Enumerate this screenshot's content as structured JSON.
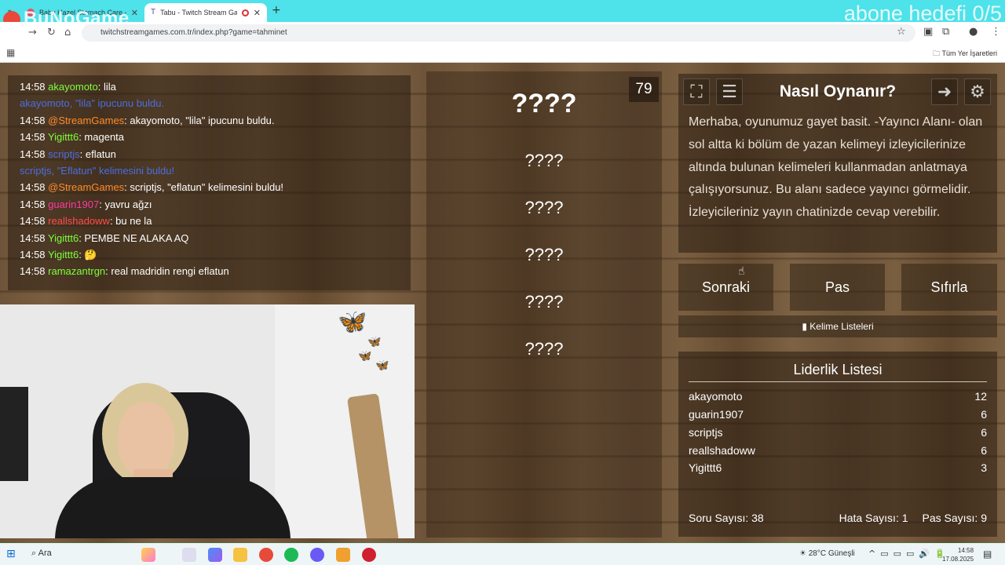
{
  "browser": {
    "tabs": [
      {
        "label": "Baby Hazel Stomach Care - Oy...",
        "active": false
      },
      {
        "label": "Tabu - Twitch Stream Games",
        "active": true
      }
    ],
    "url": "twitchstreamgames.com.tr/index.php?game=tahminet",
    "bookmarks_folder": "Tüm Yer İşaretleri",
    "overlay_logo": "BuNoGame",
    "overlay_goal": "abone hedefi 0/5"
  },
  "chat": {
    "messages": [
      {
        "time": "14:58",
        "user": "akayomoto",
        "user_color": "#7cff3a",
        "text": ": lila"
      },
      {
        "system": true,
        "text": "akayomoto, \"lila\" ipucunu buldu."
      },
      {
        "time": "14:58",
        "user": "@StreamGames",
        "user_color": "#ff8c2a",
        "text": ": akayomoto, \"lila\" ipucunu buldu."
      },
      {
        "time": "14:58",
        "user": "Yigittt6",
        "user_color": "#7cff3a",
        "text": ": magenta"
      },
      {
        "time": "14:58",
        "user": "scriptjs",
        "user_color": "#4a6ee0",
        "text": ": eflatun"
      },
      {
        "system": true,
        "text": "scriptjs, \"Eflatun\" kelimesini buldu!"
      },
      {
        "time": "14:58",
        "user": "@StreamGames",
        "user_color": "#ff8c2a",
        "text": ": scriptjs, \"eflatun\" kelimesini buldu!"
      },
      {
        "time": "14:58",
        "user": "guarin1907",
        "user_color": "#ff3aa0",
        "text": ": yavru ağzı"
      },
      {
        "time": "14:58",
        "user": "reallshadoww",
        "user_color": "#ff4a4a",
        "text": ": bu ne la"
      },
      {
        "time": "14:58",
        "user": "Yigittt6",
        "user_color": "#7cff3a",
        "text": ": PEMBE NE ALAKA AQ"
      },
      {
        "time": "14:58",
        "user": "Yigittt6",
        "user_color": "#7cff3a",
        "text": ": 🤔"
      },
      {
        "time": "14:58",
        "user": "ramazantrgn",
        "user_color": "#7cff3a",
        "text": ": real madridin rengi eflatun"
      }
    ]
  },
  "game": {
    "timer": "79",
    "main_word": "????",
    "taboo_words": [
      "????",
      "????",
      "????",
      "????",
      "????"
    ]
  },
  "help": {
    "title": "Nasıl Oynanır?",
    "text": "Merhaba, oyunumuz gayet basit. -Yayıncı Alanı- olan sol altta ki bölüm de yazan kelimeyi izleyicilerinize altında bulunan kelimeleri kullanmadan anlatmaya çalışıyorsunuz. Bu alanı sadece yayıncı görmelidir. İzleyicileriniz yayın chatinizde cevap verebilir."
  },
  "controls": {
    "next": "Sonraki",
    "pass": "Pas",
    "reset": "Sıfırla",
    "word_lists": "Kelime Listeleri"
  },
  "leaderboard": {
    "title": "Liderlik Listesi",
    "rows": [
      {
        "name": "akayomoto",
        "score": "12"
      },
      {
        "name": "guarin1907",
        "score": "6"
      },
      {
        "name": "scriptjs",
        "score": "6"
      },
      {
        "name": "reallshadoww",
        "score": "6"
      },
      {
        "name": "Yigittt6",
        "score": "3"
      }
    ]
  },
  "stats": {
    "questions": "Soru Sayısı: 38",
    "errors": "Hata Sayısı: 1",
    "passes": "Pas Sayısı: 9"
  },
  "taskbar": {
    "search": "Ara",
    "weather": "28°C Güneşli",
    "time": "14:58",
    "date": "17.08.2025"
  }
}
